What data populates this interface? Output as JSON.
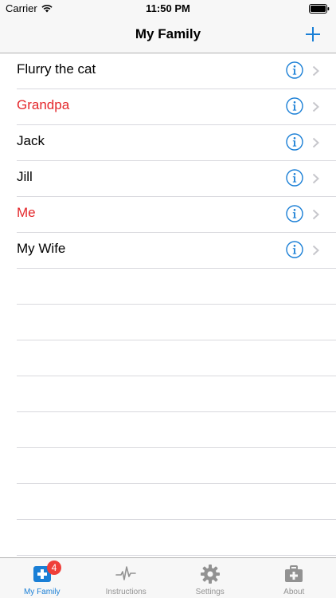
{
  "status_bar": {
    "carrier": "Carrier",
    "time": "11:50 PM"
  },
  "nav": {
    "title": "My Family"
  },
  "colors": {
    "accent": "#1a7fd6",
    "highlight_red": "#e4272b",
    "badge": "#ef3f3a"
  },
  "family_list": [
    {
      "name": "Flurry the cat",
      "highlight": false
    },
    {
      "name": "Grandpa",
      "highlight": true
    },
    {
      "name": "Jack",
      "highlight": false
    },
    {
      "name": "Jill",
      "highlight": false
    },
    {
      "name": "Me",
      "highlight": true
    },
    {
      "name": "My Wife",
      "highlight": false
    }
  ],
  "tabs": [
    {
      "label": "My Family",
      "icon": "medical-plus-icon",
      "badge": "4",
      "active": true
    },
    {
      "label": "Instructions",
      "icon": "heartbeat-icon",
      "active": false
    },
    {
      "label": "Settings",
      "icon": "gear-icon",
      "active": false
    },
    {
      "label": "About",
      "icon": "medical-kit-icon",
      "active": false
    }
  ]
}
